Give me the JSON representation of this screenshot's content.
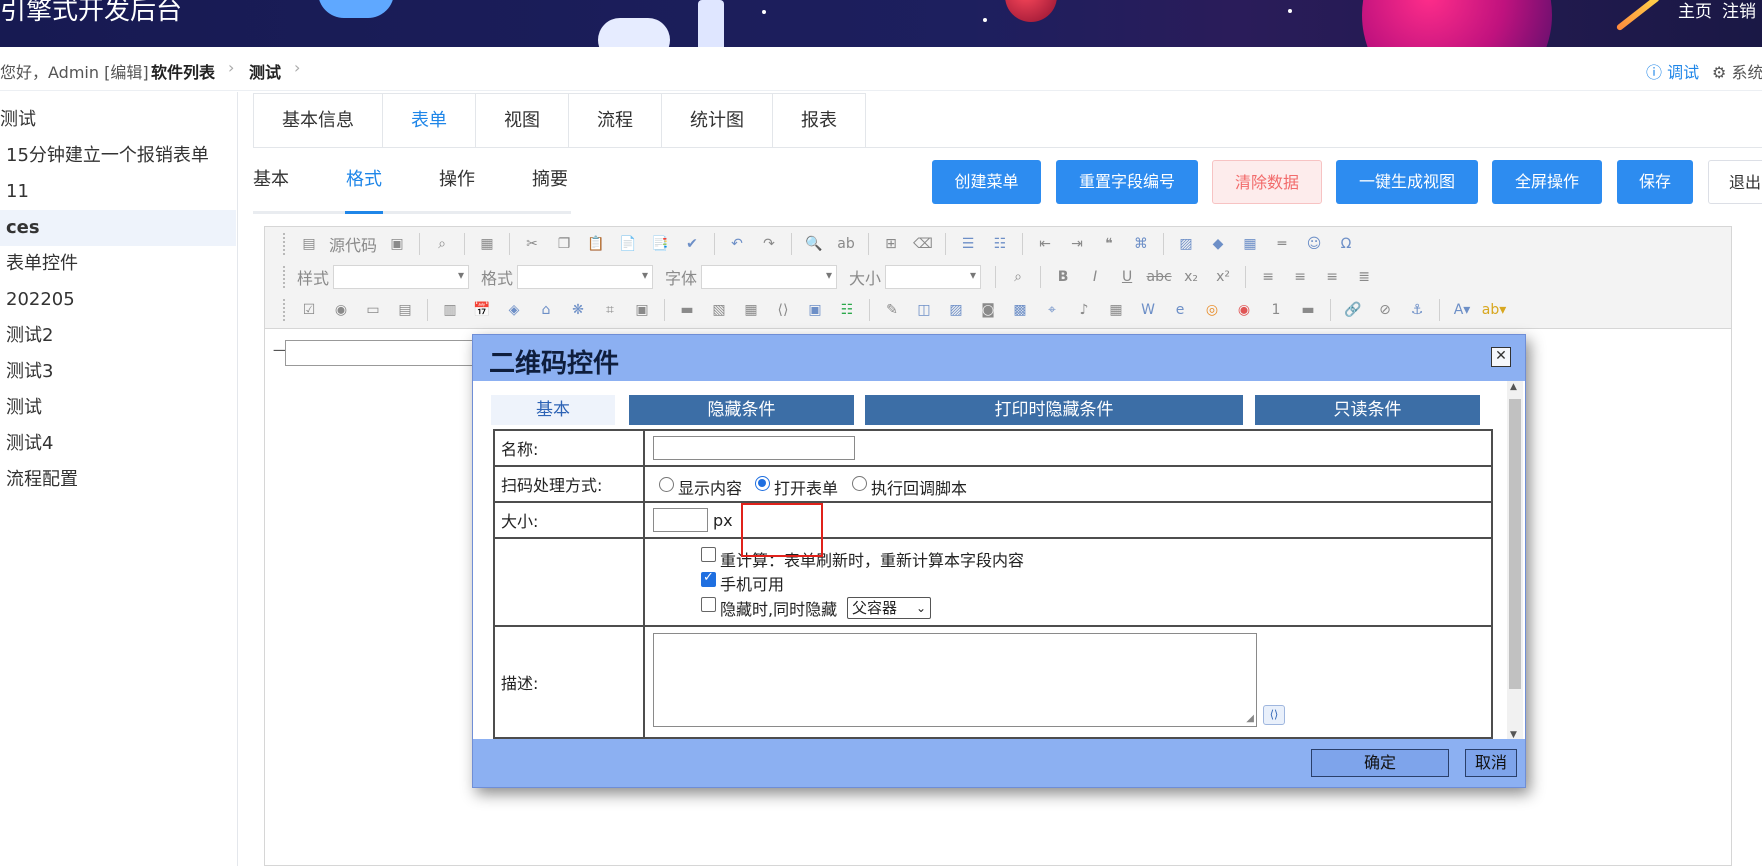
{
  "app": {
    "title": "引擎式开发后台",
    "top_links": [
      "主页",
      "注销"
    ]
  },
  "breadcrumb": {
    "greeting": "您好，Admin [编辑]",
    "items": [
      "软件列表",
      "测试"
    ],
    "right_links": [
      "调试",
      "系统"
    ]
  },
  "tree": {
    "root": "测试",
    "items": [
      "15分钟建立一个报销表单",
      "11",
      "ces",
      "表单控件",
      "202205",
      "测试2",
      "测试3",
      "测试",
      "测试4",
      "流程配置"
    ],
    "active": "ces"
  },
  "main_tabs": {
    "items": [
      "基本信息",
      "表单",
      "视图",
      "流程",
      "统计图",
      "报表"
    ],
    "active": "表单"
  },
  "sub_tabs": {
    "items": [
      "基本",
      "格式",
      "操作",
      "摘要"
    ],
    "active": "格式"
  },
  "actions": [
    "创建菜单",
    "重置字段编号",
    "清除数据",
    "一键生成视图",
    "全屏操作",
    "保存",
    "退出"
  ],
  "editor_toolbar": {
    "source_label": "源代码",
    "combos": [
      "样式",
      "格式",
      "字体",
      "大小"
    ]
  },
  "dialog": {
    "title": "二维码控件",
    "tabs": [
      "基本",
      "隐藏条件",
      "打印时隐藏条件",
      "只读条件"
    ],
    "active_tab": "基本",
    "fields": {
      "name_label": "名称:",
      "name_value": "",
      "scan_label": "扫码处理方式:",
      "scan_options": [
        "显示内容",
        "打开表单",
        "执行回调脚本"
      ],
      "scan_selected": "打开表单",
      "size_label": "大小:",
      "size_value": "",
      "size_unit": "px",
      "recalc_label": "重计算：表单刷新时，重新计算本字段内容",
      "recalc_checked": false,
      "mobile_label": "手机可用",
      "mobile_checked": true,
      "hide_label": "隐藏时,同时隐藏",
      "hide_checked": false,
      "hide_target": "父容器",
      "desc_label": "描述:",
      "desc_value": ""
    },
    "ok_label": "确定",
    "cancel_label": "取消"
  },
  "colors": {
    "primary": "#2d8cf0",
    "dialog_header": "#8cb0f2",
    "dialog_tab": "#3c6ea6",
    "highlight_box": "#e0221b"
  }
}
